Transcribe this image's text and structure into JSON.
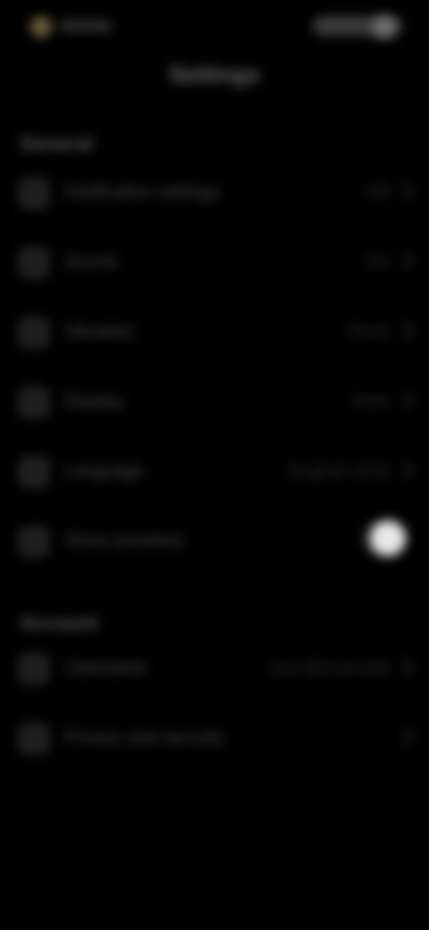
{
  "status_bar": {
    "left_text": "",
    "right_text": ""
  },
  "header": {
    "title": "Settings"
  },
  "sections": [
    {
      "header": "General",
      "rows": [
        {
          "label": "Notification settings",
          "value": "Off"
        },
        {
          "label": "Sound",
          "value": "On"
        },
        {
          "label": "Vibration",
          "value": "Short"
        },
        {
          "label": "Display",
          "value": "Auto"
        },
        {
          "label": "Language",
          "value": "English (US)"
        },
        {
          "label": "Show previews",
          "toggle_on": true
        }
      ]
    },
    {
      "header": "Account",
      "rows": [
        {
          "label": "Username",
          "value": "user@example"
        },
        {
          "label": "Privacy and security",
          "value": ""
        }
      ]
    }
  ]
}
